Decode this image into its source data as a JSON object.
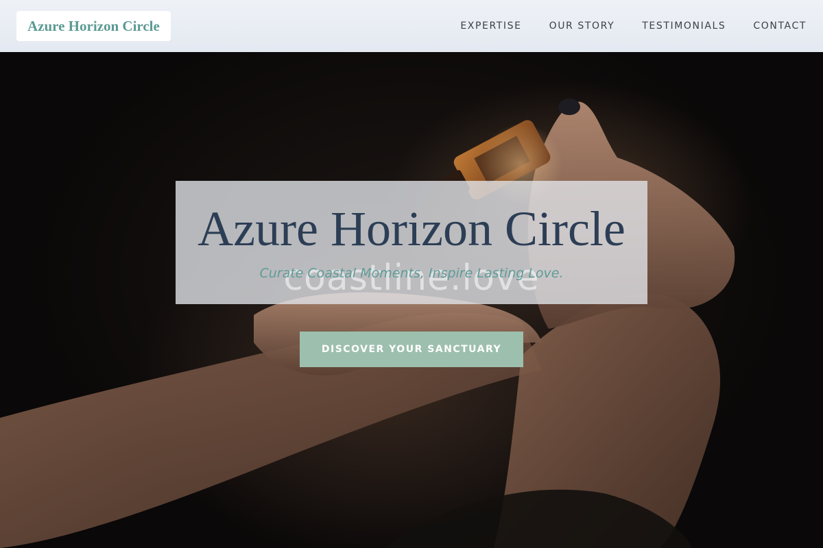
{
  "header": {
    "logo": "Azure Horizon Circle",
    "nav": [
      {
        "label": "EXPERTISE"
      },
      {
        "label": "OUR STORY"
      },
      {
        "label": "TESTIMONIALS"
      },
      {
        "label": "CONTACT"
      }
    ]
  },
  "hero": {
    "title": "Azure Horizon Circle",
    "tagline": "Curate Coastal Moments, Inspire Lasting Love.",
    "watermark": "coastline.love",
    "cta_label": "DISCOVER YOUR SANCTUARY",
    "background_image": "hands-holding-amber-oil-bottle"
  },
  "colors": {
    "brand_teal": "#5b9a93",
    "title_navy": "#2c3e55",
    "cta_sage": "#9dbfae",
    "header_bg": "#e9eef4"
  }
}
